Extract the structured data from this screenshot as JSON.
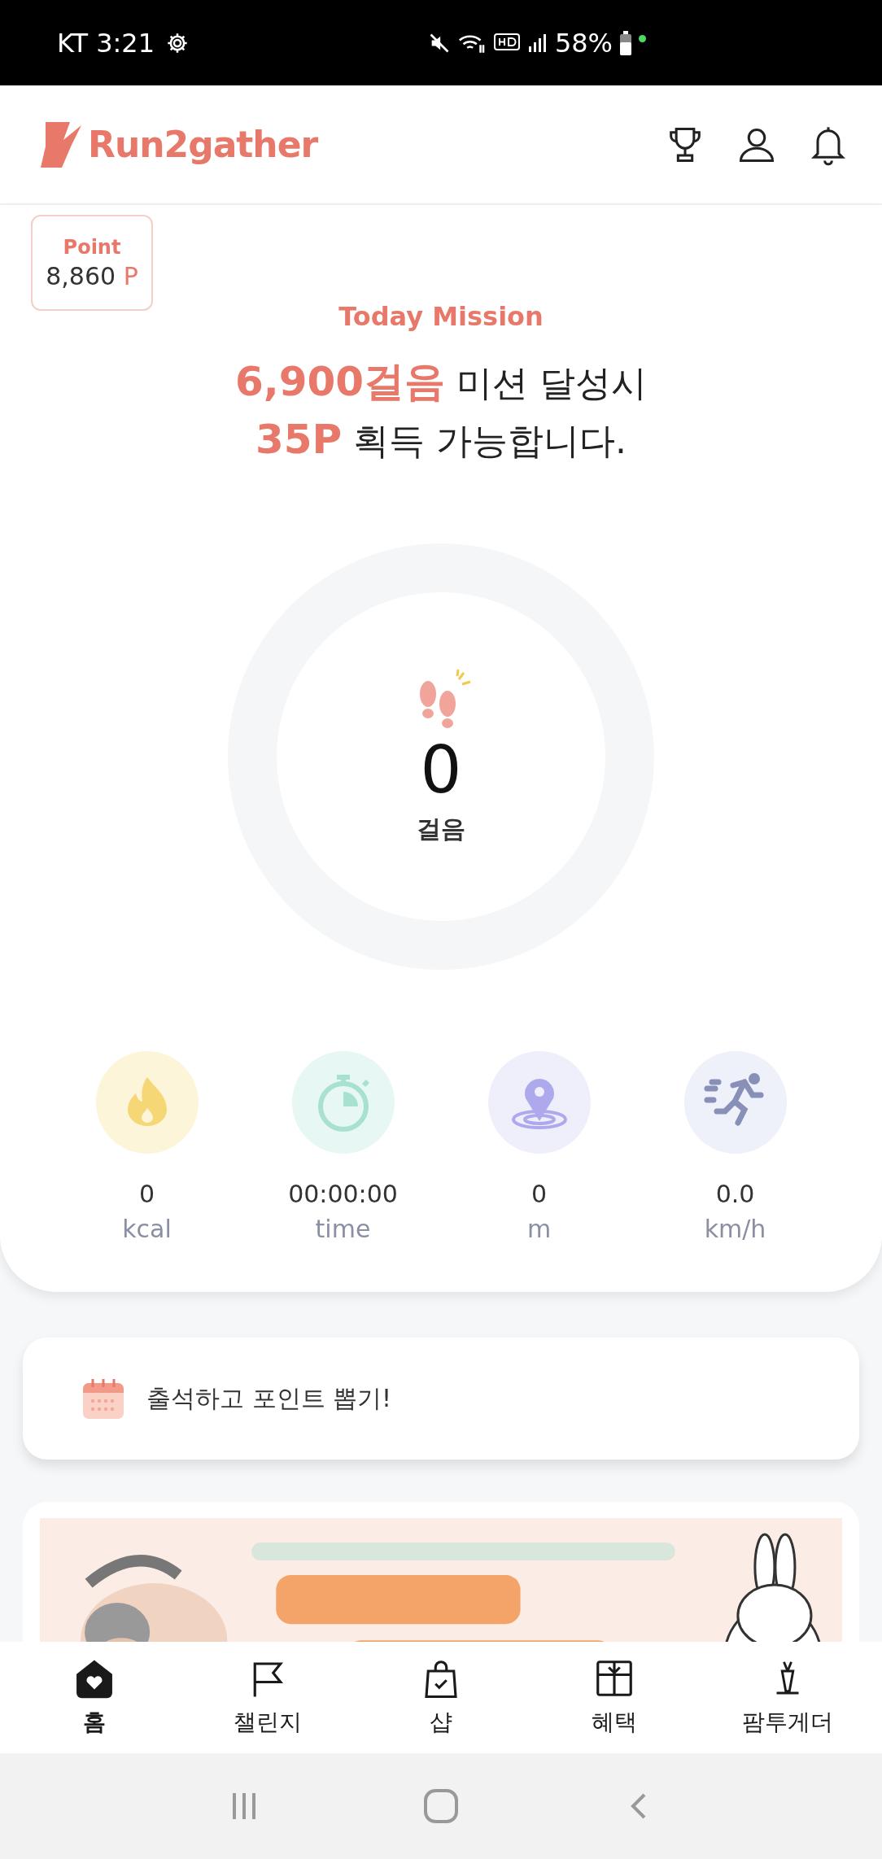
{
  "status_bar": {
    "carrier_time": "KT 3:21",
    "battery": "58%"
  },
  "header": {
    "logo": "Run2gather"
  },
  "points": {
    "label": "Point",
    "value": "8,860",
    "unit": "P"
  },
  "mission": {
    "title": "Today Mission",
    "lines": [
      {
        "highlight": "6,900걸음",
        "text": "미션 달성시"
      },
      {
        "highlight": "35P",
        "text": "획득 가능합니다."
      }
    ]
  },
  "steps": {
    "count": "0",
    "unit": "걸음"
  },
  "stats": [
    {
      "kind": "calories",
      "value": "0",
      "unit": "kcal"
    },
    {
      "kind": "time",
      "value": "00:00:00",
      "unit": "time"
    },
    {
      "kind": "distance",
      "value": "0",
      "unit": "m"
    },
    {
      "kind": "speed",
      "value": "0.0",
      "unit": "km/h"
    }
  ],
  "attendance": {
    "label": "출석하고 포인트 뽑기!"
  },
  "bottom_nav": [
    {
      "kind": "home",
      "label": "홈",
      "selected": true
    },
    {
      "kind": "challenge",
      "label": "챌린지",
      "selected": false
    },
    {
      "kind": "shop",
      "label": "샵",
      "selected": false
    },
    {
      "kind": "benefit",
      "label": "혜택",
      "selected": false
    },
    {
      "kind": "farm",
      "label": "팜투게더",
      "selected": false
    }
  ]
}
